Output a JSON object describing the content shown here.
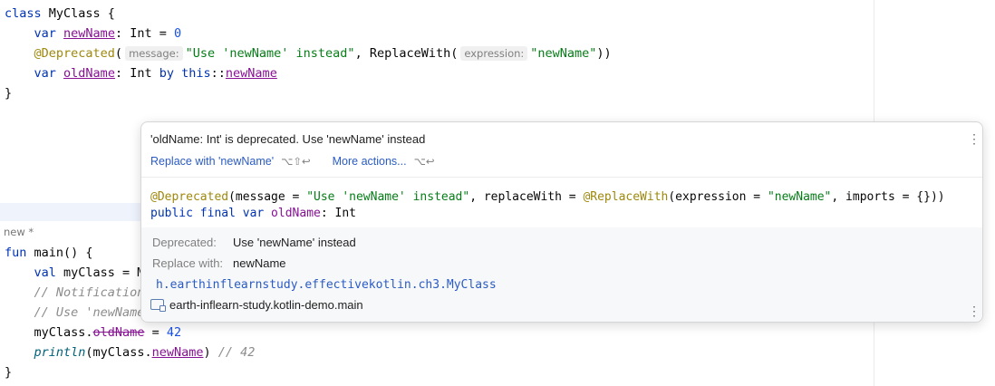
{
  "code": {
    "class_line": {
      "kw": "class",
      "name": " MyClass {"
    },
    "new_prop": {
      "kw": "var",
      "name": "newName",
      "rest": ": Int = ",
      "value": "0"
    },
    "deprecated_ann": {
      "ann": "@Deprecated",
      "open": "(",
      "hint_message": "message:",
      "message": "\"Use 'newName' instead\"",
      "mid": ", ReplaceWith(",
      "hint_expression": "expression:",
      "expression": "\"newName\"",
      "close": "))"
    },
    "old_prop": {
      "kw": "var",
      "name": "oldName",
      "rest": ": Int ",
      "kw_by": "by",
      "space": " ",
      "kw_this": "this",
      "ref": "::",
      "target": "newName"
    },
    "close_brace": "}",
    "separator_label": "new *",
    "main_line": {
      "kw": "fun",
      "rest": " main() {"
    },
    "val_line": {
      "kw": "val",
      "rest": " myClass = M"
    },
    "comment1": "// Notification",
    "comment2": "// Use 'newName",
    "assign": {
      "obj": "myClass.",
      "prop": "oldName",
      "rest": " = ",
      "value": "42"
    },
    "print": {
      "fn": "println",
      "open": "(myClass.",
      "prop": "newName",
      "close": ") ",
      "comment": "// 42"
    },
    "close_brace2": "}"
  },
  "popup": {
    "message": "'oldName: Int' is deprecated. Use 'newName' instead",
    "action_replace": "Replace with 'newName'",
    "action_replace_shortcut": "⌥⇧↩",
    "action_more": "More actions...",
    "action_more_shortcut": "⌥↩",
    "decl": {
      "ann1": "@Deprecated",
      "mid1": "(message = ",
      "msg": "\"Use 'newName' instead\"",
      "mid2": ", replaceWith = ",
      "ann2": "@ReplaceWith",
      "mid3": "(expression = ",
      "expr": "\"newName\"",
      "mid4": ", imports = {}))",
      "kw1": "public final var",
      "name": " oldName",
      "type": ": Int"
    },
    "deprecated_label": "Deprecated:",
    "deprecated_value": "Use 'newName' instead",
    "replace_label": "Replace with:",
    "replace_value": "newName",
    "fqn": "h.earthinflearnstudy.effectivekotlin.ch3.MyClass",
    "module": "earth-inflearn-study.kotlin-demo.main",
    "menu_glyph": "⋮"
  }
}
